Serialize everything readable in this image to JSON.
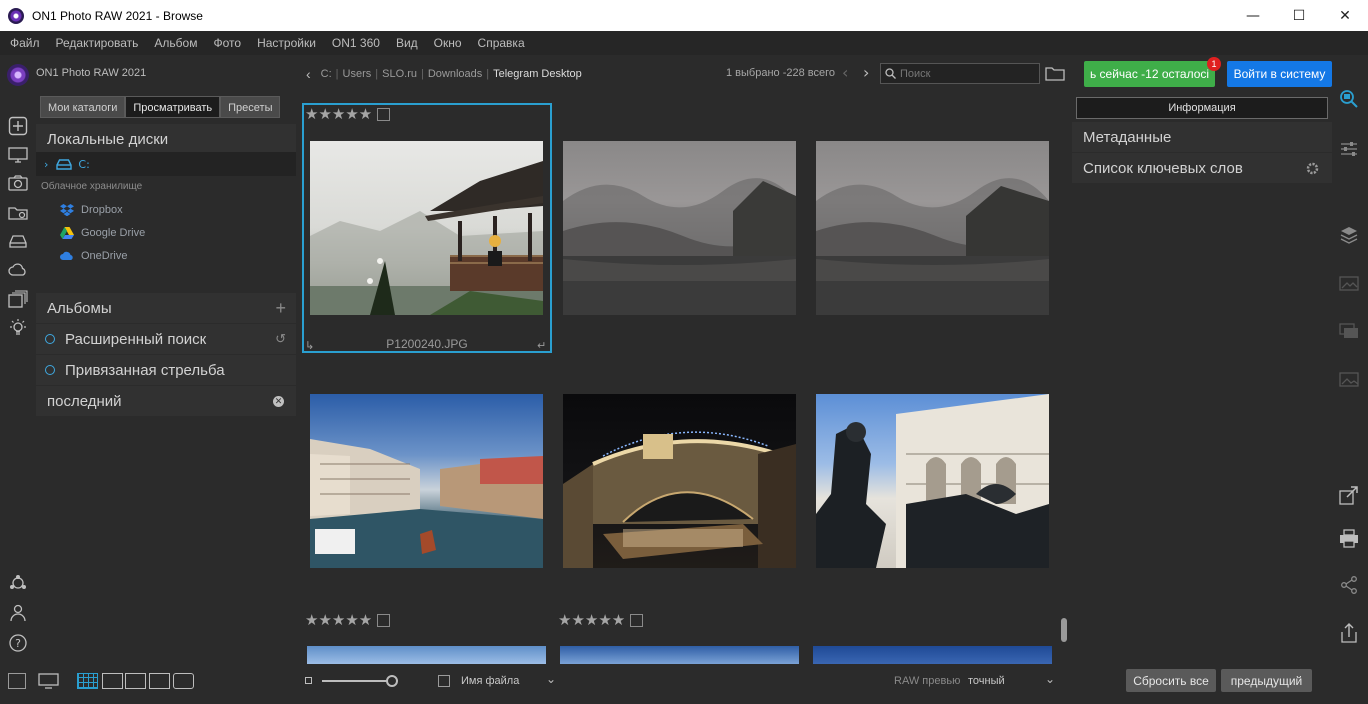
{
  "window": {
    "title": "ON1 Photo RAW 2021 - Browse",
    "minimize": "—",
    "maximize": "☐",
    "close": "✕"
  },
  "menu": [
    "Файл",
    "Редактировать",
    "Альбом",
    "Фото",
    "Настройки",
    "ON1 360",
    "Вид",
    "Окно",
    "Справка"
  ],
  "app_name": "ON1 Photo RAW 2021",
  "left_panel": {
    "tabs": [
      "Мои каталоги",
      "Просматривать",
      "Пресеты"
    ],
    "local_disks": "Локальные диски",
    "drive": "C:",
    "cloud_label": "Облачное хранилище",
    "cloud_items": [
      "Dropbox",
      "Google Drive",
      "OneDrive"
    ],
    "albums": "Альбомы",
    "advanced_search": "Расширенный поиск",
    "tethered": "Привязанная стрельба",
    "recent": "последний"
  },
  "toolbar": {
    "breadcrumb": [
      "C:",
      "Users",
      "SLO.ru",
      "Downloads",
      "Telegram Desktop"
    ],
    "count": "1 выбрано -228 всего",
    "search_placeholder": "Поиск",
    "buy_label": "ь сейчас -12 осталосі",
    "badge": "1",
    "login_label": "Войти в систему"
  },
  "right_panel": {
    "info": "Информация",
    "metadata": "Метаданные",
    "keywords": "Список ключевых слов"
  },
  "grid": {
    "selected_filename": "P1200240.JPG",
    "stars": "★★★★★"
  },
  "bottom": {
    "sort": "Имя файла",
    "preview_label": "RAW превью",
    "preview_value": "точный",
    "reset": "Сбросить все",
    "prev": "предыдущий"
  },
  "colors": {
    "accent": "#2a9fd0",
    "buy": "#3fae49",
    "login": "#1478e6",
    "badge": "#e02020"
  }
}
